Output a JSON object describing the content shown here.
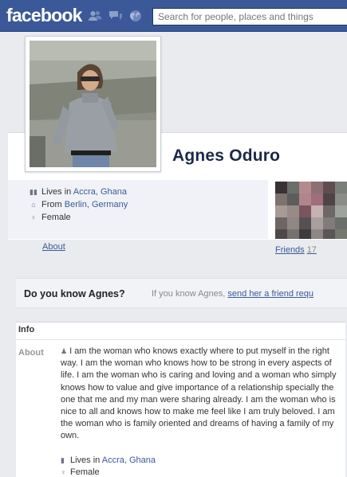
{
  "topbar": {
    "logo": "facebook",
    "search_placeholder": "Search for people, places and things",
    "icons": [
      "friend-requests-icon",
      "messages-icon",
      "notifications-globe-icon"
    ]
  },
  "profile": {
    "name": "Agnes Oduro",
    "facts": {
      "lives_prefix": "Lives in",
      "lives_place": "Accra, Ghana",
      "from_prefix": "From",
      "from_place": "Berlin, Germany",
      "gender": "Female"
    }
  },
  "tabs": {
    "about": "About",
    "friends": "Friends",
    "friends_count": "17"
  },
  "know_banner": {
    "title": "Do you know Agnes?",
    "text": "If you know Agnes,",
    "link": "send her a friend requ"
  },
  "info": {
    "header": "Info",
    "about_label": "About",
    "bio": "I am the woman who knows exactly where to put myself in the right way. I am the woman who knows how to be strong in every aspects of life. I am the woman who is caring and loving and a woman who simply knows how to value and give importance of a relationship specially the one that me and my man were sharing already. I am the woman who is nice to all and knows how to make me feel like I am truly beloved. I am the woman who is family oriented and dreams of having a family of my own.",
    "lives_prefix": "Lives in",
    "lives_place": "Accra, Ghana",
    "gender": "Female"
  },
  "colors": {
    "brand": "#3b5998",
    "link": "#3b5998",
    "background": "#e9ebee"
  }
}
